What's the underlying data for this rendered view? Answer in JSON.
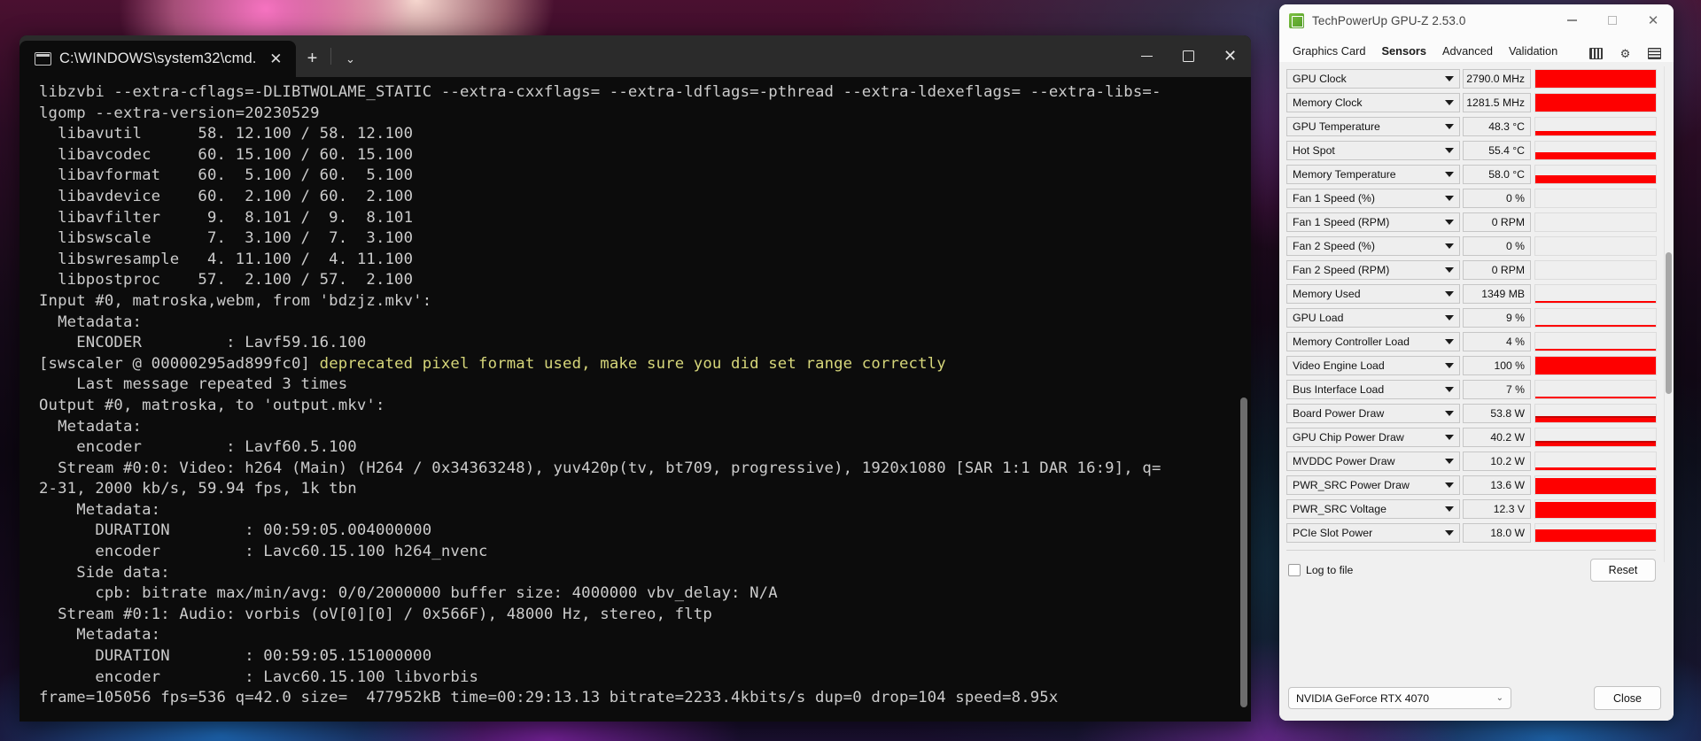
{
  "desktop": {
    "wallpaper_description": "colorful anime wallpaper"
  },
  "cmd_window": {
    "tab": {
      "title": "C:\\WINDOWS\\system32\\cmd.",
      "icon": "console-icon",
      "close_label": "✕"
    },
    "new_tab_label": "+",
    "tab_menu_label": "⌄",
    "controls": {
      "minimize": "—",
      "maximize": "□",
      "close": "✕"
    },
    "lines": [
      {
        "text": "libzvbi --extra-cflags=-DLIBTWOLAME_STATIC --extra-cxxflags= --extra-ldflags=-pthread --extra-ldexeflags= --extra-libs=-",
        "style": "normal"
      },
      {
        "text": "lgomp --extra-version=20230529",
        "style": "normal"
      },
      {
        "text": "  libavutil      58. 12.100 / 58. 12.100",
        "style": "normal"
      },
      {
        "text": "  libavcodec     60. 15.100 / 60. 15.100",
        "style": "normal"
      },
      {
        "text": "  libavformat    60.  5.100 / 60.  5.100",
        "style": "normal"
      },
      {
        "text": "  libavdevice    60.  2.100 / 60.  2.100",
        "style": "normal"
      },
      {
        "text": "  libavfilter     9.  8.101 /  9.  8.101",
        "style": "normal"
      },
      {
        "text": "  libswscale      7.  3.100 /  7.  3.100",
        "style": "normal"
      },
      {
        "text": "  libswresample   4. 11.100 /  4. 11.100",
        "style": "normal"
      },
      {
        "text": "  libpostproc    57.  2.100 / 57.  2.100",
        "style": "normal"
      },
      {
        "text": "Input #0, matroska,webm, from 'bdzjz.mkv':",
        "style": "normal"
      },
      {
        "text": "  Metadata:",
        "style": "normal"
      },
      {
        "text": "    ENCODER         : Lavf59.16.100",
        "style": "normal"
      },
      {
        "text": "[swscaler @ 00000295ad899fc0] ",
        "style": "warn-prefix",
        "warn_text": "deprecated pixel format used, make sure you did set range correctly"
      },
      {
        "text": "    Last message repeated 3 times",
        "style": "normal"
      },
      {
        "text": "Output #0, matroska, to 'output.mkv':",
        "style": "normal"
      },
      {
        "text": "  Metadata:",
        "style": "normal"
      },
      {
        "text": "    encoder         : Lavf60.5.100",
        "style": "normal"
      },
      {
        "text": "  Stream #0:0: Video: h264 (Main) (H264 / 0x34363248), yuv420p(tv, bt709, progressive), 1920x1080 [SAR 1:1 DAR 16:9], q=",
        "style": "normal"
      },
      {
        "text": "2-31, 2000 kb/s, 59.94 fps, 1k tbn",
        "style": "normal"
      },
      {
        "text": "    Metadata:",
        "style": "normal"
      },
      {
        "text": "      DURATION        : 00:59:05.004000000",
        "style": "normal"
      },
      {
        "text": "      encoder         : Lavc60.15.100 h264_nvenc",
        "style": "normal"
      },
      {
        "text": "    Side data:",
        "style": "normal"
      },
      {
        "text": "      cpb: bitrate max/min/avg: 0/0/2000000 buffer size: 4000000 vbv_delay: N/A",
        "style": "normal"
      },
      {
        "text": "  Stream #0:1: Audio: vorbis (oV[0][0] / 0x566F), 48000 Hz, stereo, fltp",
        "style": "normal"
      },
      {
        "text": "    Metadata:",
        "style": "normal"
      },
      {
        "text": "      DURATION        : 00:59:05.151000000",
        "style": "normal"
      },
      {
        "text": "      encoder         : Lavc60.15.100 libvorbis",
        "style": "normal"
      },
      {
        "text": "frame=105056 fps=536 q=42.0 size=  477952kB time=00:29:13.13 bitrate=2233.4kbits/s dup=0 drop=104 speed=8.95x",
        "style": "normal"
      }
    ]
  },
  "gpuz_window": {
    "title": "TechPowerUp GPU-Z 2.53.0",
    "controls": {
      "minimize": "—",
      "maximize": "□",
      "close": "✕"
    },
    "tabs": [
      {
        "label": "Graphics Card",
        "active": false
      },
      {
        "label": "Sensors",
        "active": true
      },
      {
        "label": "Advanced",
        "active": false
      },
      {
        "label": "Validation",
        "active": false
      }
    ],
    "toolbar_icons": [
      "camera-icon",
      "gear-icon",
      "menu-icon"
    ],
    "accent_color": "#fe0000",
    "sensors": [
      {
        "name": "GPU Clock",
        "value": "2790.0 MHz",
        "fill": 100,
        "noise": 0
      },
      {
        "name": "Memory Clock",
        "value": "1281.5 MHz",
        "fill": 100,
        "noise": 0
      },
      {
        "name": "GPU Temperature",
        "value": "48.3 °C",
        "fill": 26,
        "noise": 0
      },
      {
        "name": "Hot Spot",
        "value": "55.4 °C",
        "fill": 40,
        "noise": 0
      },
      {
        "name": "Memory Temperature",
        "value": "58.0 °C",
        "fill": 46,
        "noise": 0
      },
      {
        "name": "Fan 1 Speed (%)",
        "value": "0 %",
        "fill": 0,
        "noise": 0
      },
      {
        "name": "Fan 1 Speed (RPM)",
        "value": "0 RPM",
        "fill": 0,
        "noise": 0
      },
      {
        "name": "Fan 2 Speed (%)",
        "value": "0 %",
        "fill": 0,
        "noise": 0
      },
      {
        "name": "Fan 2 Speed (RPM)",
        "value": "0 RPM",
        "fill": 0,
        "noise": 0
      },
      {
        "name": "Memory Used",
        "value": "1349 MB",
        "fill": 9,
        "noise": 0
      },
      {
        "name": "GPU Load",
        "value": "9 %",
        "fill": 8,
        "noise": 0
      },
      {
        "name": "Memory Controller Load",
        "value": "4 %",
        "fill": 7,
        "noise": 0
      },
      {
        "name": "Video Engine Load",
        "value": "100 %",
        "fill": 100,
        "noise": 0
      },
      {
        "name": "Bus Interface Load",
        "value": "7 %",
        "fill": 9,
        "noise": 0
      },
      {
        "name": "Board Power Draw",
        "value": "53.8 W",
        "fill": 24,
        "noise": 14
      },
      {
        "name": "GPU Chip Power Draw",
        "value": "40.2 W",
        "fill": 22,
        "noise": 13
      },
      {
        "name": "MVDDC Power Draw",
        "value": "10.2 W",
        "fill": 17,
        "noise": 0
      },
      {
        "name": "PWR_SRC Power Draw",
        "value": "13.6 W",
        "fill": 92,
        "noise": 0
      },
      {
        "name": "PWR_SRC Voltage",
        "value": "12.3 V",
        "fill": 88,
        "noise": 0
      },
      {
        "name": "PCIe Slot Power",
        "value": "18.0 W",
        "fill": 72,
        "noise": 0
      }
    ],
    "log_to_file": {
      "label": "Log to file",
      "checked": false
    },
    "reset_label": "Reset",
    "gpu_select": {
      "value": "NVIDIA GeForce RTX 4070",
      "caret": "⌄"
    },
    "close_label": "Close"
  }
}
